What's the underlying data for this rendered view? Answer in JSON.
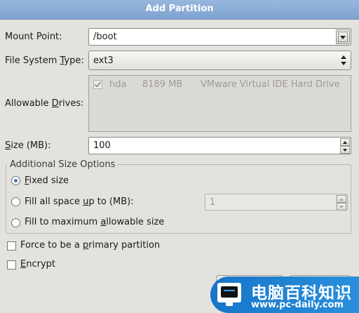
{
  "window": {
    "title": "Add Partition"
  },
  "mount_point": {
    "label_pre": "Mount Point:",
    "value": "/boot"
  },
  "fs_type": {
    "label_pre": "File System ",
    "label_ul": "T",
    "label_post": "ype:",
    "value": "ext3"
  },
  "drives": {
    "label_pre": "Allowable ",
    "label_ul": "D",
    "label_post": "rives:",
    "rows": [
      {
        "checked": true,
        "name": "hda",
        "size": "8189 MB",
        "model": "VMware Virtual IDE Hard Drive"
      }
    ]
  },
  "size": {
    "label_ul": "S",
    "label_post": "ize (MB):",
    "value": "100"
  },
  "size_options": {
    "title": "Additional Size Options",
    "fixed": {
      "label_ul": "F",
      "label_post": "ixed size",
      "selected": true
    },
    "fill_up": {
      "label_pre": "Fill all space ",
      "label_ul": "u",
      "label_post": "p to (MB):",
      "selected": false,
      "value": "1"
    },
    "fill_max": {
      "label_pre": "Fill to maximum ",
      "label_ul": "a",
      "label_post": "llowable size",
      "selected": false
    }
  },
  "primary": {
    "label_pre": "Force to be a ",
    "label_ul": "p",
    "label_post": "rimary partition",
    "checked": false
  },
  "encrypt": {
    "label_ul": "E",
    "label_post": "ncrypt",
    "checked": false
  },
  "watermark": {
    "brand": "电脑百科知识",
    "url": "www.pc-daily.com"
  },
  "colors": {
    "titlebar": "#8aaedb",
    "radio_dot": "#4b79b5",
    "watermark_bg": "#1f84d2"
  },
  "icons": {
    "combo": "chevron-down-icon",
    "spin": "spin-arrows-icon",
    "check": "checkmark-icon"
  }
}
